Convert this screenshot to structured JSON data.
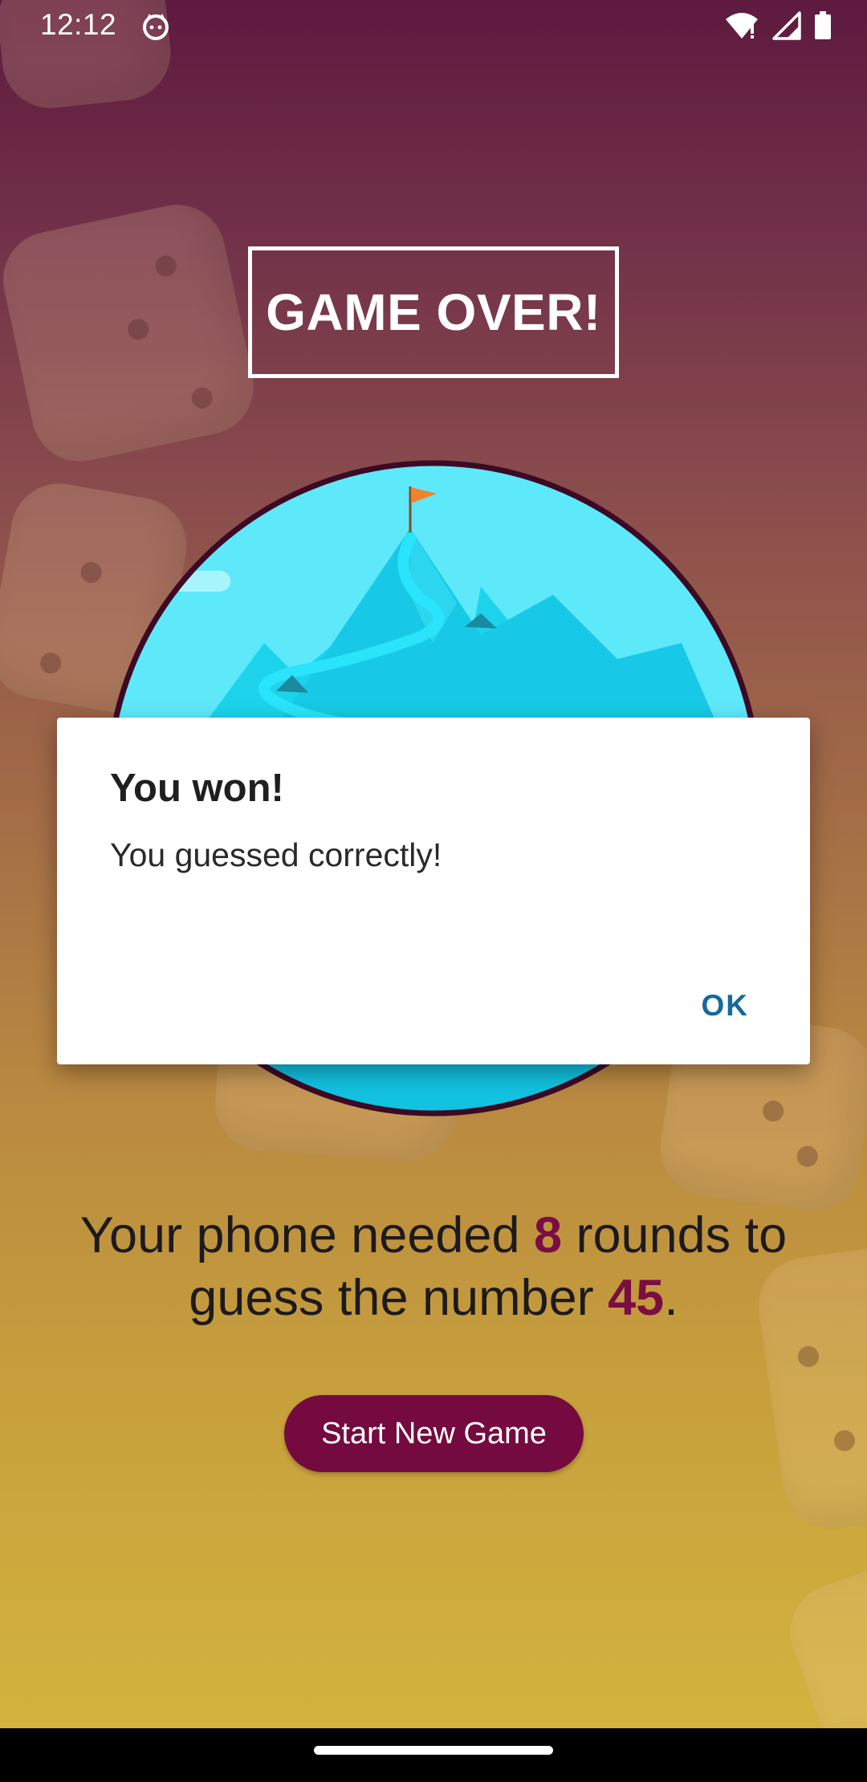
{
  "status_bar": {
    "time": "12:12",
    "app_icon": "cat-face-icon",
    "wifi_icon": "wifi-icon",
    "signal_icon": "cell-signal-icon",
    "battery_icon": "battery-icon"
  },
  "title": "GAME OVER!",
  "illustration": {
    "icon": "mountain-summit-flag-icon"
  },
  "result": {
    "prefix": "Your phone needed ",
    "rounds": "8",
    "middle": " rounds to guess the number ",
    "number": "45",
    "suffix": "."
  },
  "start_button_label": "Start New Game",
  "dialog": {
    "title": "You won!",
    "message": "You guessed correctly!",
    "ok_label": "OK"
  },
  "colors": {
    "accent": "#740a3f",
    "highlight": "#7a0d43",
    "dialog_button": "#136a9c",
    "sky": "#5ee9fb"
  }
}
